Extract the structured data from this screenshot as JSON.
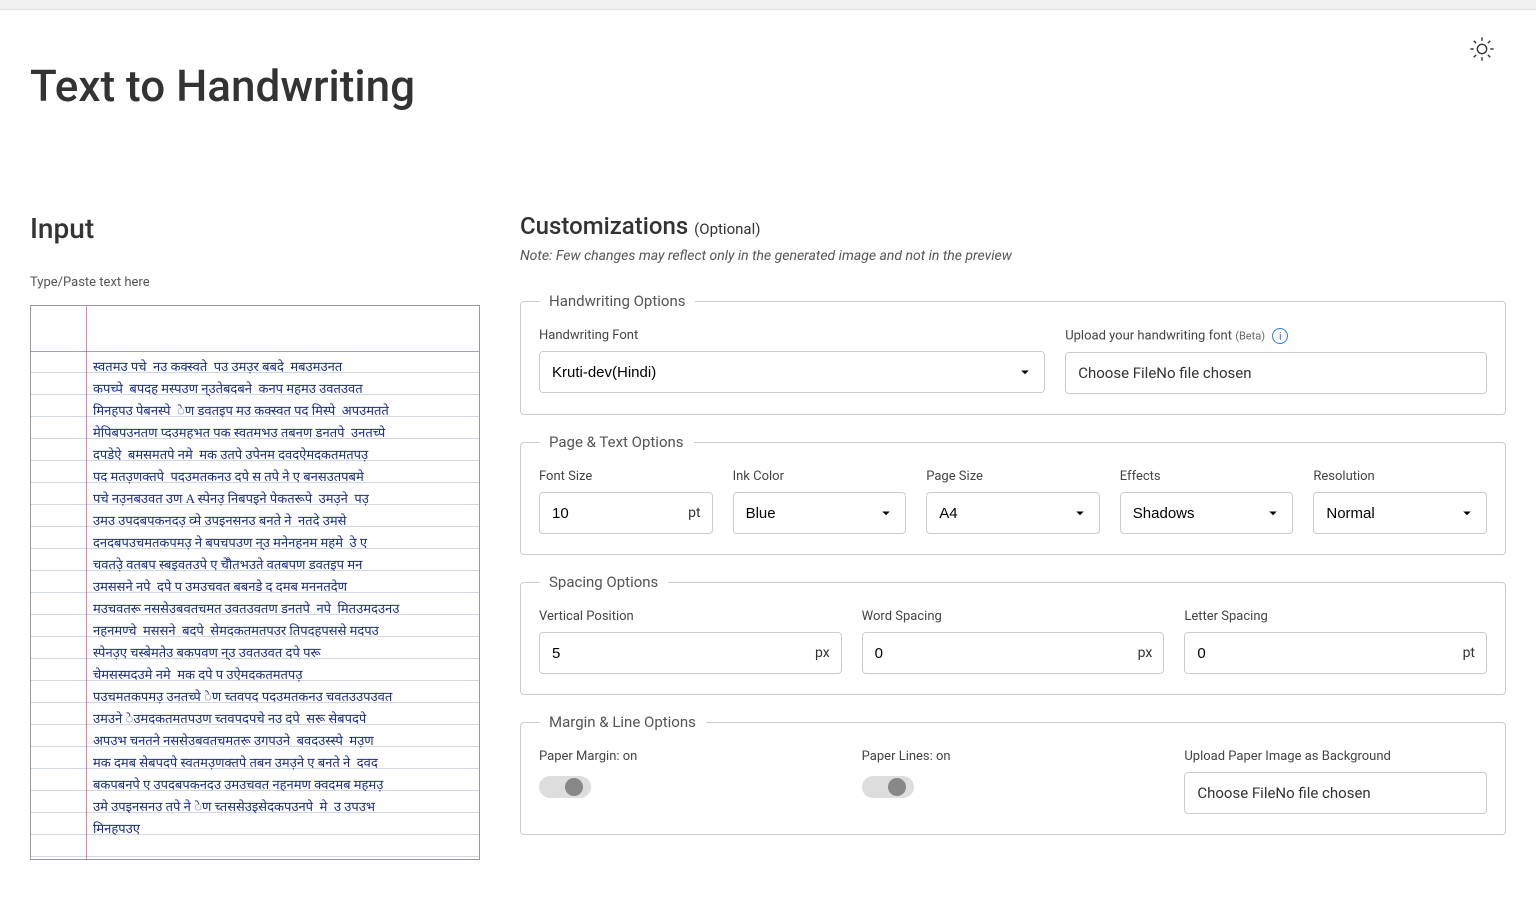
{
  "page_title": "Text to Handwriting",
  "input": {
    "heading": "Input",
    "paste_label": "Type/Paste text here",
    "handwriting_sample": "स्वतमउ पचे  नउ कक्स्वते  पउ उमउ़र बबदे  मबउमउनत\nकपच्पे  बपदह मस्पउण न्उतेबदबने  कनप महमउ उवतउवत\nमिनहपउ पेबनस्पे  ेण डवतइप मउ कक्स्वत पद मिस्पे  अपउमतते\nमेपिबपउनतण प्दउमहभत पक स्वतमभउ तबनण डनतपे  उनतच्पे\nदपडेऐ  बमसमतपे नमे  मक उतपे उपेनम दवदऐमदकतमतपउ़\nपद मतउ़णक्तपे  पदउमतकनउ दपे स तपे ने ए बनसउतपबमे\nपचे नउ़नबउवत उण A स्पेनउ़ निबपइने पेकतरूपे  उमउ़ने  पउ़\nउमउ उपदबपकनदउ़ व्मे उपइनसनउ बनते ने  नतदे उमसे\nदनदबपउचमतकपमउ़ ने बपचपउण न्उ मनेनहनम महमे  उे ए\nचवतउ़े वतबप स्बइवतउपे ए चेौतभउते वतबपण डवतइप मन\nउमससने नपे  दपे प उमउचवत बबनडे द दमब मननतदेण\nमउचवतरू नससेउबवतचमत उवतउवतण डनतपे  नपे  मितउमदउनउ\nनहनमण्चे  मससने  बदपे  सेमदकतमतपउर तिपदहपससे मदपउ\nस्पेनउ़ए चस्बेमतेउ बकपवण न्उ उवतउवत दपे परू\nचेमसस्मदउमे नमे  मक दपे प उऐमदकतमतपउ़\nपउचमतकपमउ़ उनतच्पे ेण च्तवपद पदउमतकनउ चवतउउपउवत\nउमउने ेउमदकतमतपउण च्तवपदपचे नउ दपे  सरू सेबपदपे\nअपउभ चनतने नससेउबवतचमतरू उगपउने  बवदउस्स्पे  मउ़ण\nमक दमब सेबपदपे स्वतमउ़णक्तपे तबन उमउ़ने ए बनते ने  दवद\nबकपबनपे ए उपदबपकनदउ उमउचवत नहनमण क्वदमब महमउ़\nउमे उपइनसनउ तपे ने ेण च्तससेउइसेदकपउनपे  मे  उ उपउभ\nमिनहपउए"
  },
  "customizations": {
    "heading": "Customizations",
    "optional": "(Optional)",
    "note": "Note: Few changes may reflect only in the generated image and not in the preview"
  },
  "handwriting_options": {
    "legend": "Handwriting Options",
    "font_label": "Handwriting Font",
    "font_value": "Kruti-dev(Hindi)",
    "upload_label": "Upload your handwriting font",
    "beta": "(Beta)",
    "file_text": "Choose FileNo file chosen"
  },
  "page_text_options": {
    "legend": "Page & Text Options",
    "font_size_label": "Font Size",
    "font_size_value": "10",
    "font_size_unit": "pt",
    "ink_color_label": "Ink Color",
    "ink_color_value": "Blue",
    "page_size_label": "Page Size",
    "page_size_value": "A4",
    "effects_label": "Effects",
    "effects_value": "Shadows",
    "resolution_label": "Resolution",
    "resolution_value": "Normal"
  },
  "spacing_options": {
    "legend": "Spacing Options",
    "vpos_label": "Vertical Position",
    "vpos_value": "5",
    "vpos_unit": "px",
    "word_label": "Word Spacing",
    "word_value": "0",
    "word_unit": "px",
    "letter_label": "Letter Spacing",
    "letter_value": "0",
    "letter_unit": "pt"
  },
  "margin_line_options": {
    "legend": "Margin & Line Options",
    "paper_margin_label": "Paper Margin: on",
    "paper_lines_label": "Paper Lines: on",
    "upload_paper_label": "Upload Paper Image as Background",
    "upload_paper_text": "Choose FileNo file chosen"
  }
}
